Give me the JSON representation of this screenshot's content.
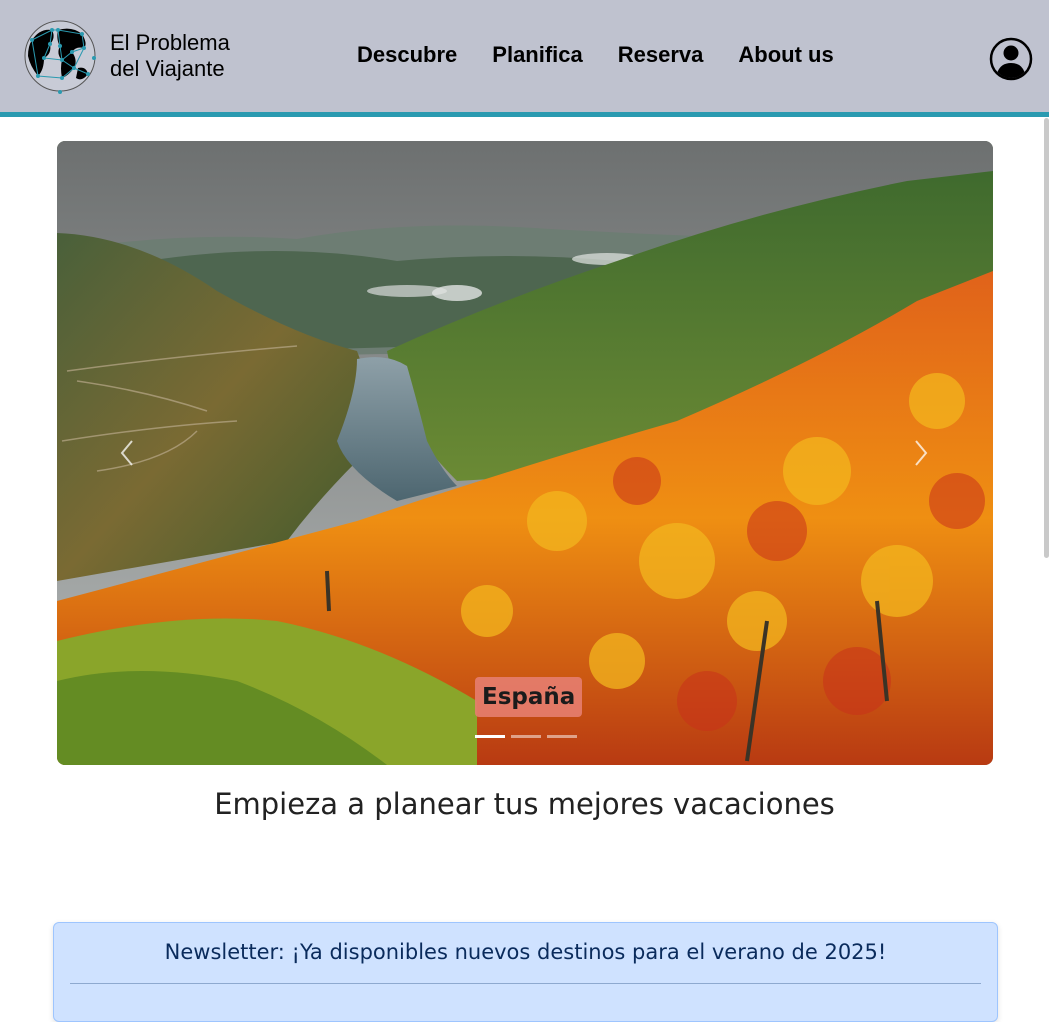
{
  "header": {
    "brand_line1": "El Problema",
    "brand_line2": "del Viajante",
    "logo_icon": "globe-network-icon",
    "account_icon": "user-circle-icon"
  },
  "nav": {
    "items": [
      {
        "label": "Descubre"
      },
      {
        "label": "Planifica"
      },
      {
        "label": "Reserva"
      },
      {
        "label": "About us"
      }
    ]
  },
  "carousel": {
    "caption": "España",
    "slide_count": 3,
    "active_index": 0,
    "prev_icon": "chevron-left-icon",
    "next_icon": "chevron-right-icon"
  },
  "main": {
    "headline": "Empieza a planear tus mejores vacaciones"
  },
  "newsletter": {
    "title": "Newsletter: ¡Ya disponibles nuevos destinos para el verano de 2025!"
  },
  "colors": {
    "header_bg": "#bfc2cf",
    "header_accent": "#2a9ab0",
    "caption_bg": "#e57d6e",
    "newsletter_bg": "#cfe2ff",
    "newsletter_text": "#0a2b5c"
  }
}
